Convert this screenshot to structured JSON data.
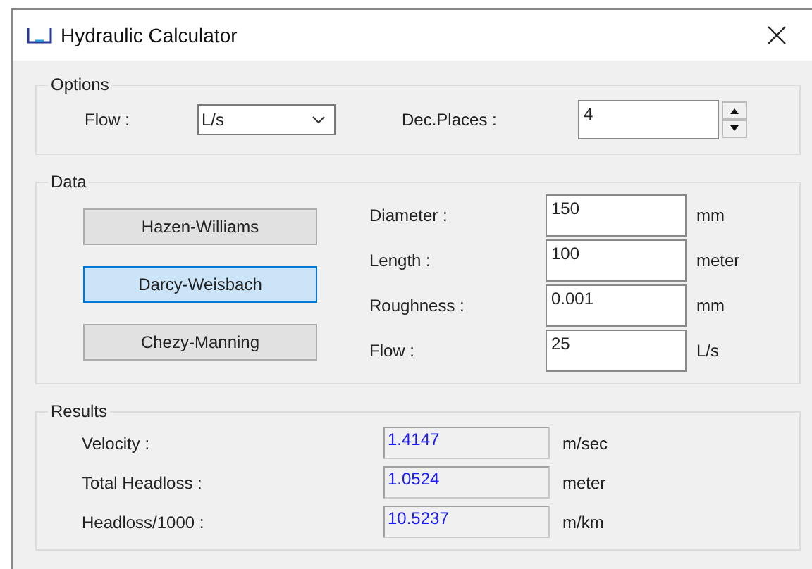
{
  "window": {
    "title": "Hydraulic Calculator"
  },
  "options": {
    "title": "Options",
    "flow_label": "Flow :",
    "flow_unit": "L/s",
    "dec_label": "Dec.Places :",
    "dec_value": "4"
  },
  "data": {
    "title": "Data",
    "methods": [
      {
        "label": "Hazen-Williams",
        "selected": false
      },
      {
        "label": "Darcy-Weisbach",
        "selected": true
      },
      {
        "label": "Chezy-Manning",
        "selected": false
      }
    ],
    "fields": [
      {
        "label": "Diameter :",
        "value": "150",
        "unit": "mm"
      },
      {
        "label": "Length :",
        "value": "100",
        "unit": "meter"
      },
      {
        "label": "Roughness :",
        "value": "0.001",
        "unit": "mm"
      },
      {
        "label": "Flow :",
        "value": "25",
        "unit": "L/s"
      }
    ]
  },
  "results": {
    "title": "Results",
    "rows": [
      {
        "label": "Velocity :",
        "value": "1.4147",
        "unit": "m/sec"
      },
      {
        "label": "Total Headloss :",
        "value": "1.0524",
        "unit": "meter"
      },
      {
        "label": "Headloss/1000 :",
        "value": "10.5237",
        "unit": "m/km"
      }
    ]
  }
}
